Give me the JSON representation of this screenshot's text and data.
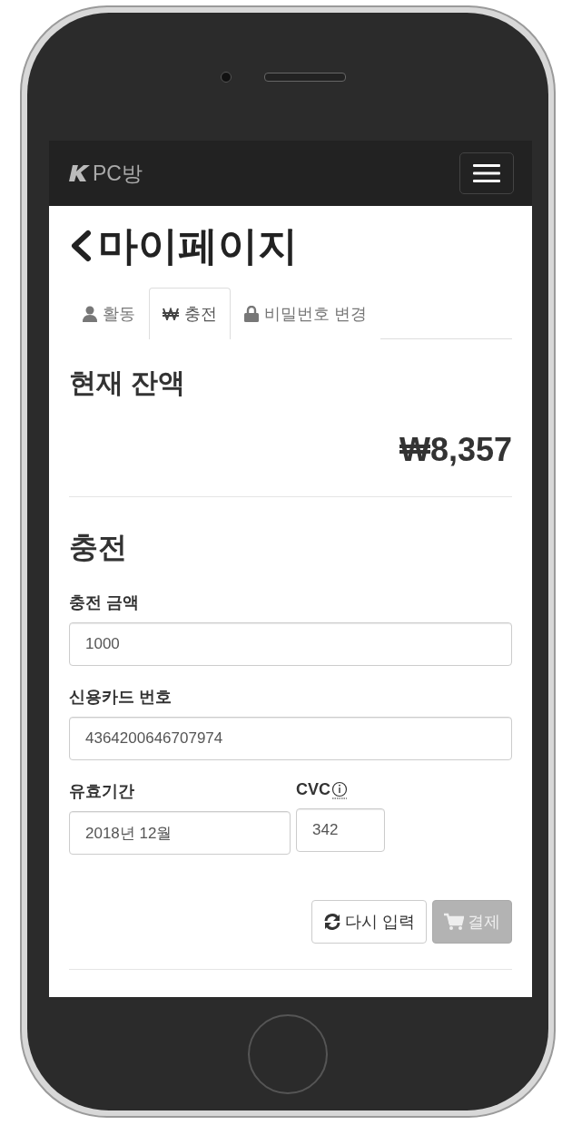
{
  "navbar": {
    "brand": "PC방"
  },
  "page_title": "마이페이지",
  "tabs": [
    {
      "kind": "user",
      "label": "활동",
      "selected": false
    },
    {
      "kind": "won",
      "label": "충전",
      "selected": true
    },
    {
      "kind": "lock",
      "label": "비밀번호 변경",
      "selected": false
    }
  ],
  "balance": {
    "heading": "현재 잔액",
    "amount": "₩8,357"
  },
  "charge": {
    "heading": "충전",
    "amount_field": {
      "label": "충전 금액",
      "value": "1000"
    },
    "card_field": {
      "label": "신용카드 번호",
      "value": "4364200646707974"
    },
    "expiry_field": {
      "label": "유효기간",
      "value": "2018년 12월"
    },
    "cvc_field": {
      "label": "CVC",
      "value": "342"
    },
    "buttons": [
      {
        "kind": "reset",
        "label": "다시 입력",
        "disabled": false
      },
      {
        "kind": "pay",
        "label": "결제",
        "disabled": true
      }
    ]
  }
}
